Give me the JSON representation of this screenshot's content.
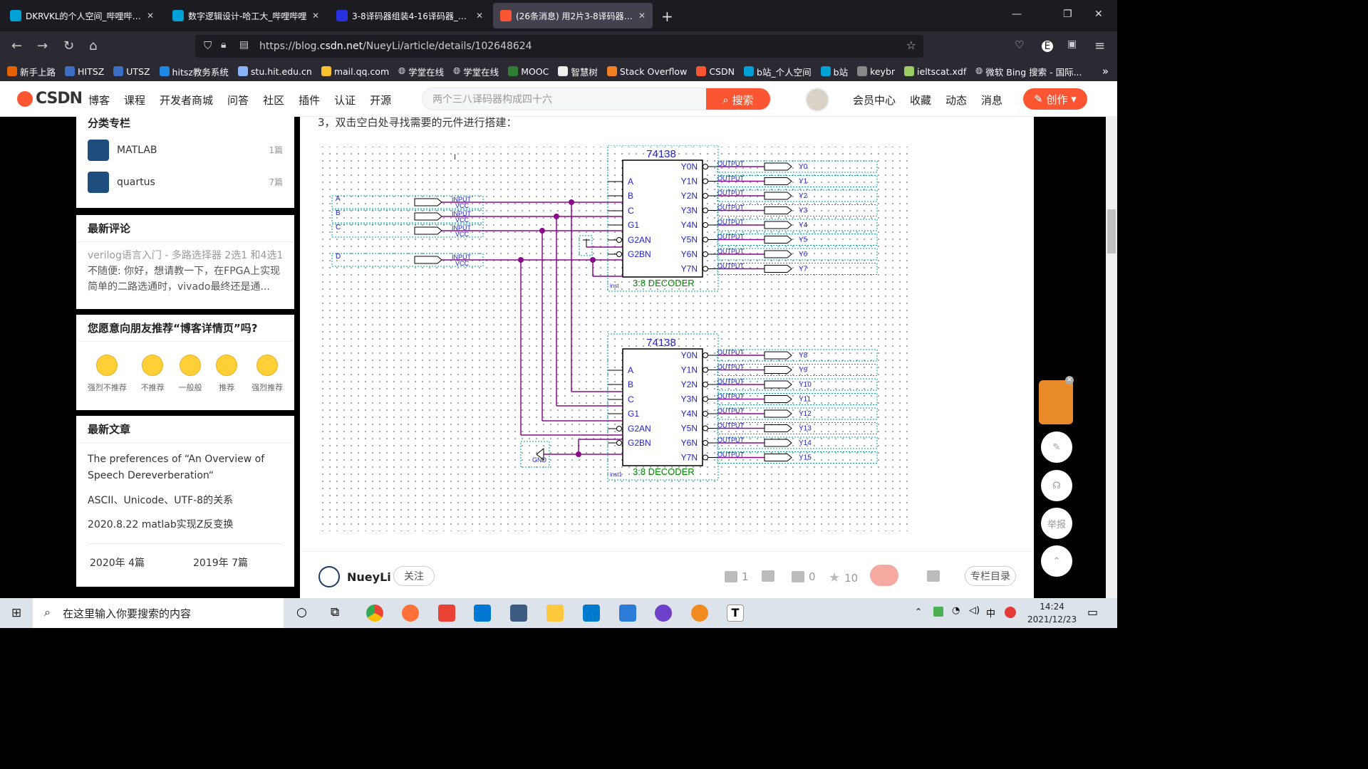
{
  "browser": {
    "tabs": [
      {
        "title": "DKRVKL的个人空间_哔哩哔哩_哔",
        "color": "#00a1d6"
      },
      {
        "title": "数字逻辑设计-哈工大_哔哩哔哩",
        "color": "#00a1d6"
      },
      {
        "title": "3-8译码器组装4-16译码器_百度",
        "color": "#2932e1"
      },
      {
        "title": "(26条消息) 用2片3-8译码器拼接",
        "color": "#fc5531"
      }
    ],
    "url_prefix": "https://blog.",
    "url_domain": "csdn.net",
    "url_path": "/NueyLi/article/details/102648624",
    "bookmarks": [
      "新手上路",
      "HITSZ",
      "UTSZ",
      "hitsz教务系统",
      "stu.hit.edu.cn",
      "mail.qq.com",
      "学堂在线",
      "学堂在线",
      "MOOC",
      "智慧树",
      "Stack Overflow",
      "CSDN",
      "b站_个人空间",
      "b站",
      "keybr",
      "ieltscat.xdf",
      "微软 Bing 搜索 - 国际..."
    ]
  },
  "csdn": {
    "logo": "CSDN",
    "nav": [
      "博客",
      "课程",
      "开发者商城",
      "问答",
      "社区",
      "插件",
      "认证",
      "开源"
    ],
    "search_placeholder": "两个三八译码器构成四十六",
    "search_button": "搜索",
    "right": [
      "会员中心",
      "收藏",
      "动态",
      "消息"
    ],
    "create": "创作"
  },
  "sidebar": {
    "columns_title": "分类专栏",
    "columns": [
      {
        "name": "MATLAB",
        "count": "1篇"
      },
      {
        "name": "quartus",
        "count": "7篇"
      }
    ],
    "comments_title": "最新评论",
    "comment_article": "verilog语言入门 - 多路选择器 2选1 和4选1",
    "comment_text": "不随便: 你好，想请教一下，在FPGA上实现简单的二路选通时，vivado最终还是通...",
    "recommend_title": "您愿意向朋友推荐“博客详情页”吗?",
    "ratings": [
      "强烈不推荐",
      "不推荐",
      "一般般",
      "推荐",
      "强烈推荐"
    ],
    "latest_title": "最新文章",
    "latest": [
      "The preferences of “An Overview of Speech Dereverberation“",
      "ASCII、Unicode、UTF-8的关系",
      "2020.8.22 matlab实现Z反变换"
    ],
    "archive": [
      "2020年  4篇",
      "2019年  7篇"
    ]
  },
  "article": {
    "step": "3，双击空白处寻找需要的元件进行搭建：",
    "chip_name": "74138",
    "decoder_label": "3:8 DECODER",
    "inst1": "inst",
    "inst2": "inst1",
    "inputs": [
      "A",
      "B",
      "C",
      "D"
    ],
    "input_tag": "INPUT",
    "vcc_tag": "VCC",
    "output_tag": "OUTPUT",
    "gnd": "GND",
    "chip_pins_left": [
      "A",
      "B",
      "C",
      "G1",
      "G2AN",
      "G2BN"
    ],
    "chip_pins_right": [
      "Y0N",
      "Y1N",
      "Y2N",
      "Y3N",
      "Y4N",
      "Y5N",
      "Y6N",
      "Y7N"
    ],
    "outputs_top": [
      "Y0",
      "Y1",
      "Y2",
      "Y3",
      "Y4",
      "Y5",
      "Y6",
      "Y7"
    ],
    "outputs_bottom": [
      "Y8",
      "Y9",
      "Y10",
      "Y11",
      "Y12",
      "Y13",
      "Y14",
      "Y15"
    ],
    "cursor": "I"
  },
  "footer": {
    "author": "NueyLi",
    "follow": "关注",
    "likes": "1",
    "comments": "0",
    "stars": "10",
    "toc": "专栏目录"
  },
  "float": {
    "report": "举报"
  },
  "taskbar": {
    "search": "在这里输入你要搜索的内容",
    "time": "14:24",
    "date": "2021/12/23",
    "ime": "中"
  }
}
